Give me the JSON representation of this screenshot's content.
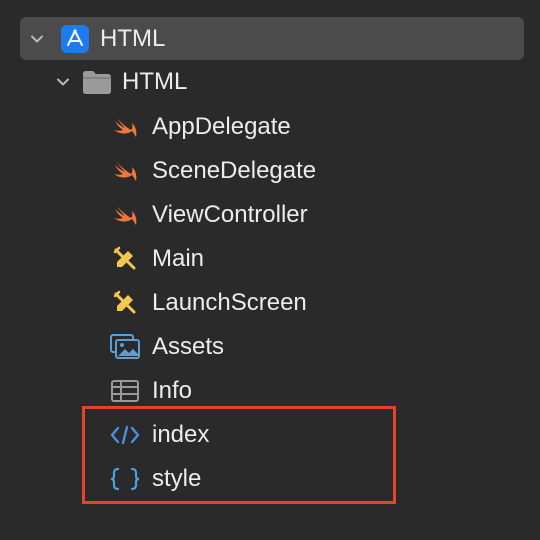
{
  "project": {
    "name": "HTML",
    "expanded": true,
    "icon": "xcode-project-icon"
  },
  "group": {
    "name": "HTML",
    "expanded": true,
    "icon": "folder-icon"
  },
  "files": [
    {
      "label": "AppDelegate",
      "icon": "swift-icon"
    },
    {
      "label": "SceneDelegate",
      "icon": "swift-icon"
    },
    {
      "label": "ViewController",
      "icon": "swift-icon"
    },
    {
      "label": "Main",
      "icon": "storyboard-icon"
    },
    {
      "label": "LaunchScreen",
      "icon": "storyboard-icon"
    },
    {
      "label": "Assets",
      "icon": "asset-catalog-icon"
    },
    {
      "label": "Info",
      "icon": "plist-table-icon"
    },
    {
      "label": "index",
      "icon": "html-code-icon"
    },
    {
      "label": "style",
      "icon": "css-braces-icon"
    }
  ],
  "highlight": {
    "color": "#e4432d",
    "items": [
      "index",
      "style"
    ]
  },
  "colors": {
    "background": "#2a2a2a",
    "selected_row": "#4b4b4b",
    "swift": "#f0793a",
    "storyboard": "#f2c94c",
    "code_blue": "#4a90e2",
    "asset_blue": "#5a9fd4"
  }
}
